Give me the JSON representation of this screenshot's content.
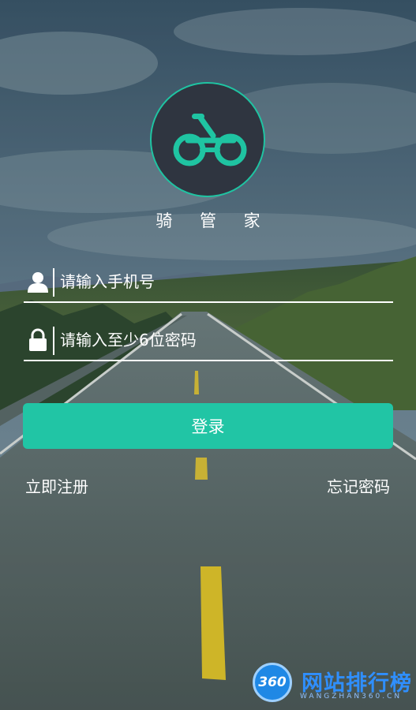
{
  "app": {
    "name": "骑 管 家",
    "logo_icon": "bicycle-icon"
  },
  "login_form": {
    "phone_placeholder": "请输入手机号",
    "phone_icon": "user-icon",
    "password_placeholder": "请输入至少6位密码",
    "password_icon": "lock-icon",
    "login_button": "登录"
  },
  "links": {
    "register": "立即注册",
    "forgot_password": "忘记密码"
  },
  "watermark": {
    "badge": "360",
    "title": "网站排行榜",
    "subtitle": "WANGZHAN360.CN"
  },
  "colors": {
    "accent": "#21c5a5",
    "logo_bg": "#2f3540"
  }
}
